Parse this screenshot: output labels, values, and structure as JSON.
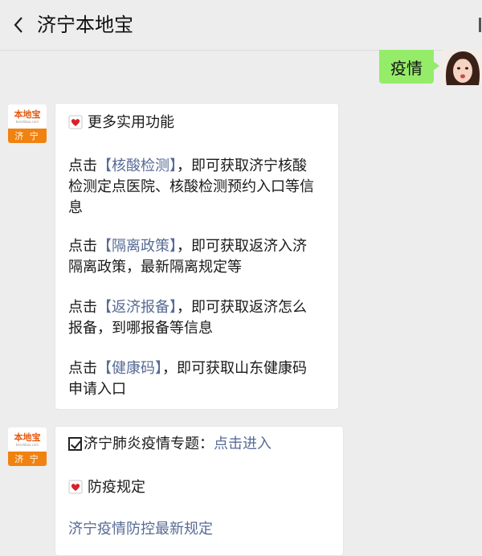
{
  "header": {
    "title": "济宁本地宝"
  },
  "outgoing": {
    "text": "疫情"
  },
  "account": {
    "brand": "本地宝",
    "url": "bendibao.com",
    "city": "济 宁"
  },
  "bubble1": {
    "heading": "更多实用功能",
    "items": [
      {
        "pre": "点击",
        "link": "【核酸检测】",
        "line1_post": "，即可获取济宁核酸",
        "line2": "检测定点医院、核酸检测预约入口等信",
        "line3": "息"
      },
      {
        "pre": "点击",
        "link": "【隔离政策】",
        "line1_post": "，即可获取返济入济",
        "line2": "隔离政策，最新隔离规定等"
      },
      {
        "pre": "点击",
        "link": "【返济报备】",
        "line1_post": "，即可获取返济怎么",
        "line2": "报备，到哪报备等信息"
      },
      {
        "pre": "点击",
        "link": "【健康码】",
        "line1_post": "，即可获取山东健康码",
        "line2": "申请入口"
      }
    ]
  },
  "bubble2": {
    "topic_text": "济宁肺炎疫情专题：",
    "topic_link": "点击进入",
    "heading": "防疫规定",
    "link": "济宁疫情防控最新规定"
  },
  "colors": {
    "link": "#576b95",
    "outgoing_bubble": "#95ec69",
    "background": "#ededed",
    "brand_orange": "#f08211"
  },
  "icons": [
    "back-chevron-icon",
    "heart-icon",
    "checkbox-icon"
  ]
}
